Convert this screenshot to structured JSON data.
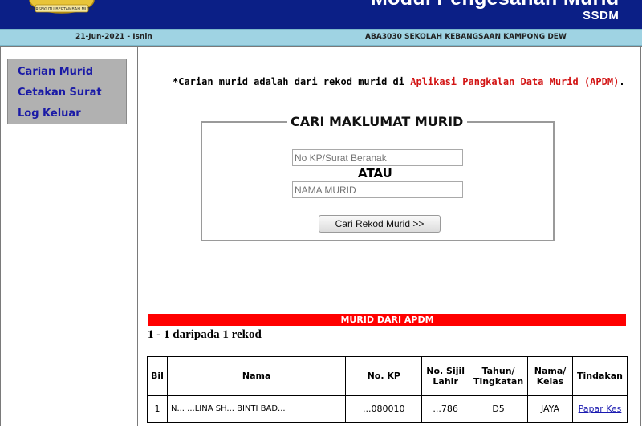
{
  "header": {
    "title": "Modul Pengesahan Murid",
    "subtitle": "SSDM",
    "crest_motto": "BERSEKUTU BERTAMBAH MUTU"
  },
  "infobar": {
    "date": "21-Jun-2021 - Isnin",
    "school": "ABA3030 SEKOLAH KEBANGSAAN KAMPONG DEW"
  },
  "sidebar": {
    "items": [
      {
        "label": "Carian Murid"
      },
      {
        "label": "Cetakan Surat"
      },
      {
        "label": "Log Keluar"
      }
    ]
  },
  "notice": {
    "prefix": "*Carian murid adalah dari rekod murid di ",
    "highlight": "Aplikasi Pangkalan Data Murid (APDM)",
    "suffix": "."
  },
  "search": {
    "legend": "CARI MAKLUMAT MURID",
    "kp_placeholder": "No KP/Surat Beranak",
    "or_label": "ATAU",
    "name_placeholder": "NAMA MURID",
    "button": "Cari Rekod Murid >>"
  },
  "results": {
    "banner": "MURID DARI APDM",
    "count": "1 - 1 daripada 1 rekod",
    "columns": [
      "Bil",
      "Nama",
      "No. KP",
      "No. Sijil Lahir",
      "Tahun/ Tingkatan",
      "Nama/ Kelas",
      "Tindakan"
    ],
    "rows": [
      {
        "bil": "1",
        "nama": "N...  ...LINA SH...  BINTI BAD...",
        "no_kp": "...080010",
        "sijil": "...786",
        "tahun": "D5",
        "kelas": "JAYA",
        "tindakan": "Papar Kes"
      }
    ]
  },
  "colors": {
    "banner": "#0b1f86",
    "infobar": "#9fd3e3",
    "menu_bg": "#b1b1b1",
    "menu_text": "#1a1aa6",
    "accent_red": "#ff0000"
  }
}
